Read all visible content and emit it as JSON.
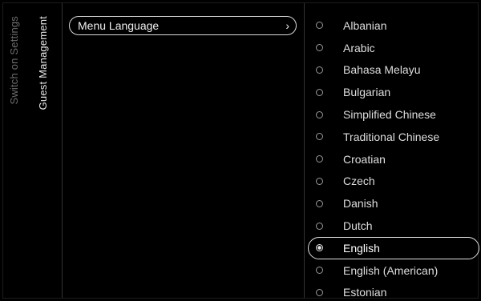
{
  "breadcrumbs": {
    "parent": "Switch on Settings",
    "current": "Guest Management"
  },
  "menu": {
    "item_label": "Menu Language",
    "chevron": "›"
  },
  "languages": [
    {
      "label": "Albanian",
      "selected": false
    },
    {
      "label": "Arabic",
      "selected": false
    },
    {
      "label": "Bahasa Melayu",
      "selected": false
    },
    {
      "label": "Bulgarian",
      "selected": false
    },
    {
      "label": "Simplified Chinese",
      "selected": false
    },
    {
      "label": "Traditional Chinese",
      "selected": false
    },
    {
      "label": "Croatian",
      "selected": false
    },
    {
      "label": "Czech",
      "selected": false
    },
    {
      "label": "Danish",
      "selected": false
    },
    {
      "label": "Dutch",
      "selected": false
    },
    {
      "label": "English",
      "selected": true
    },
    {
      "label": "English (American)",
      "selected": false
    },
    {
      "label": "Estonian",
      "selected": false
    }
  ]
}
